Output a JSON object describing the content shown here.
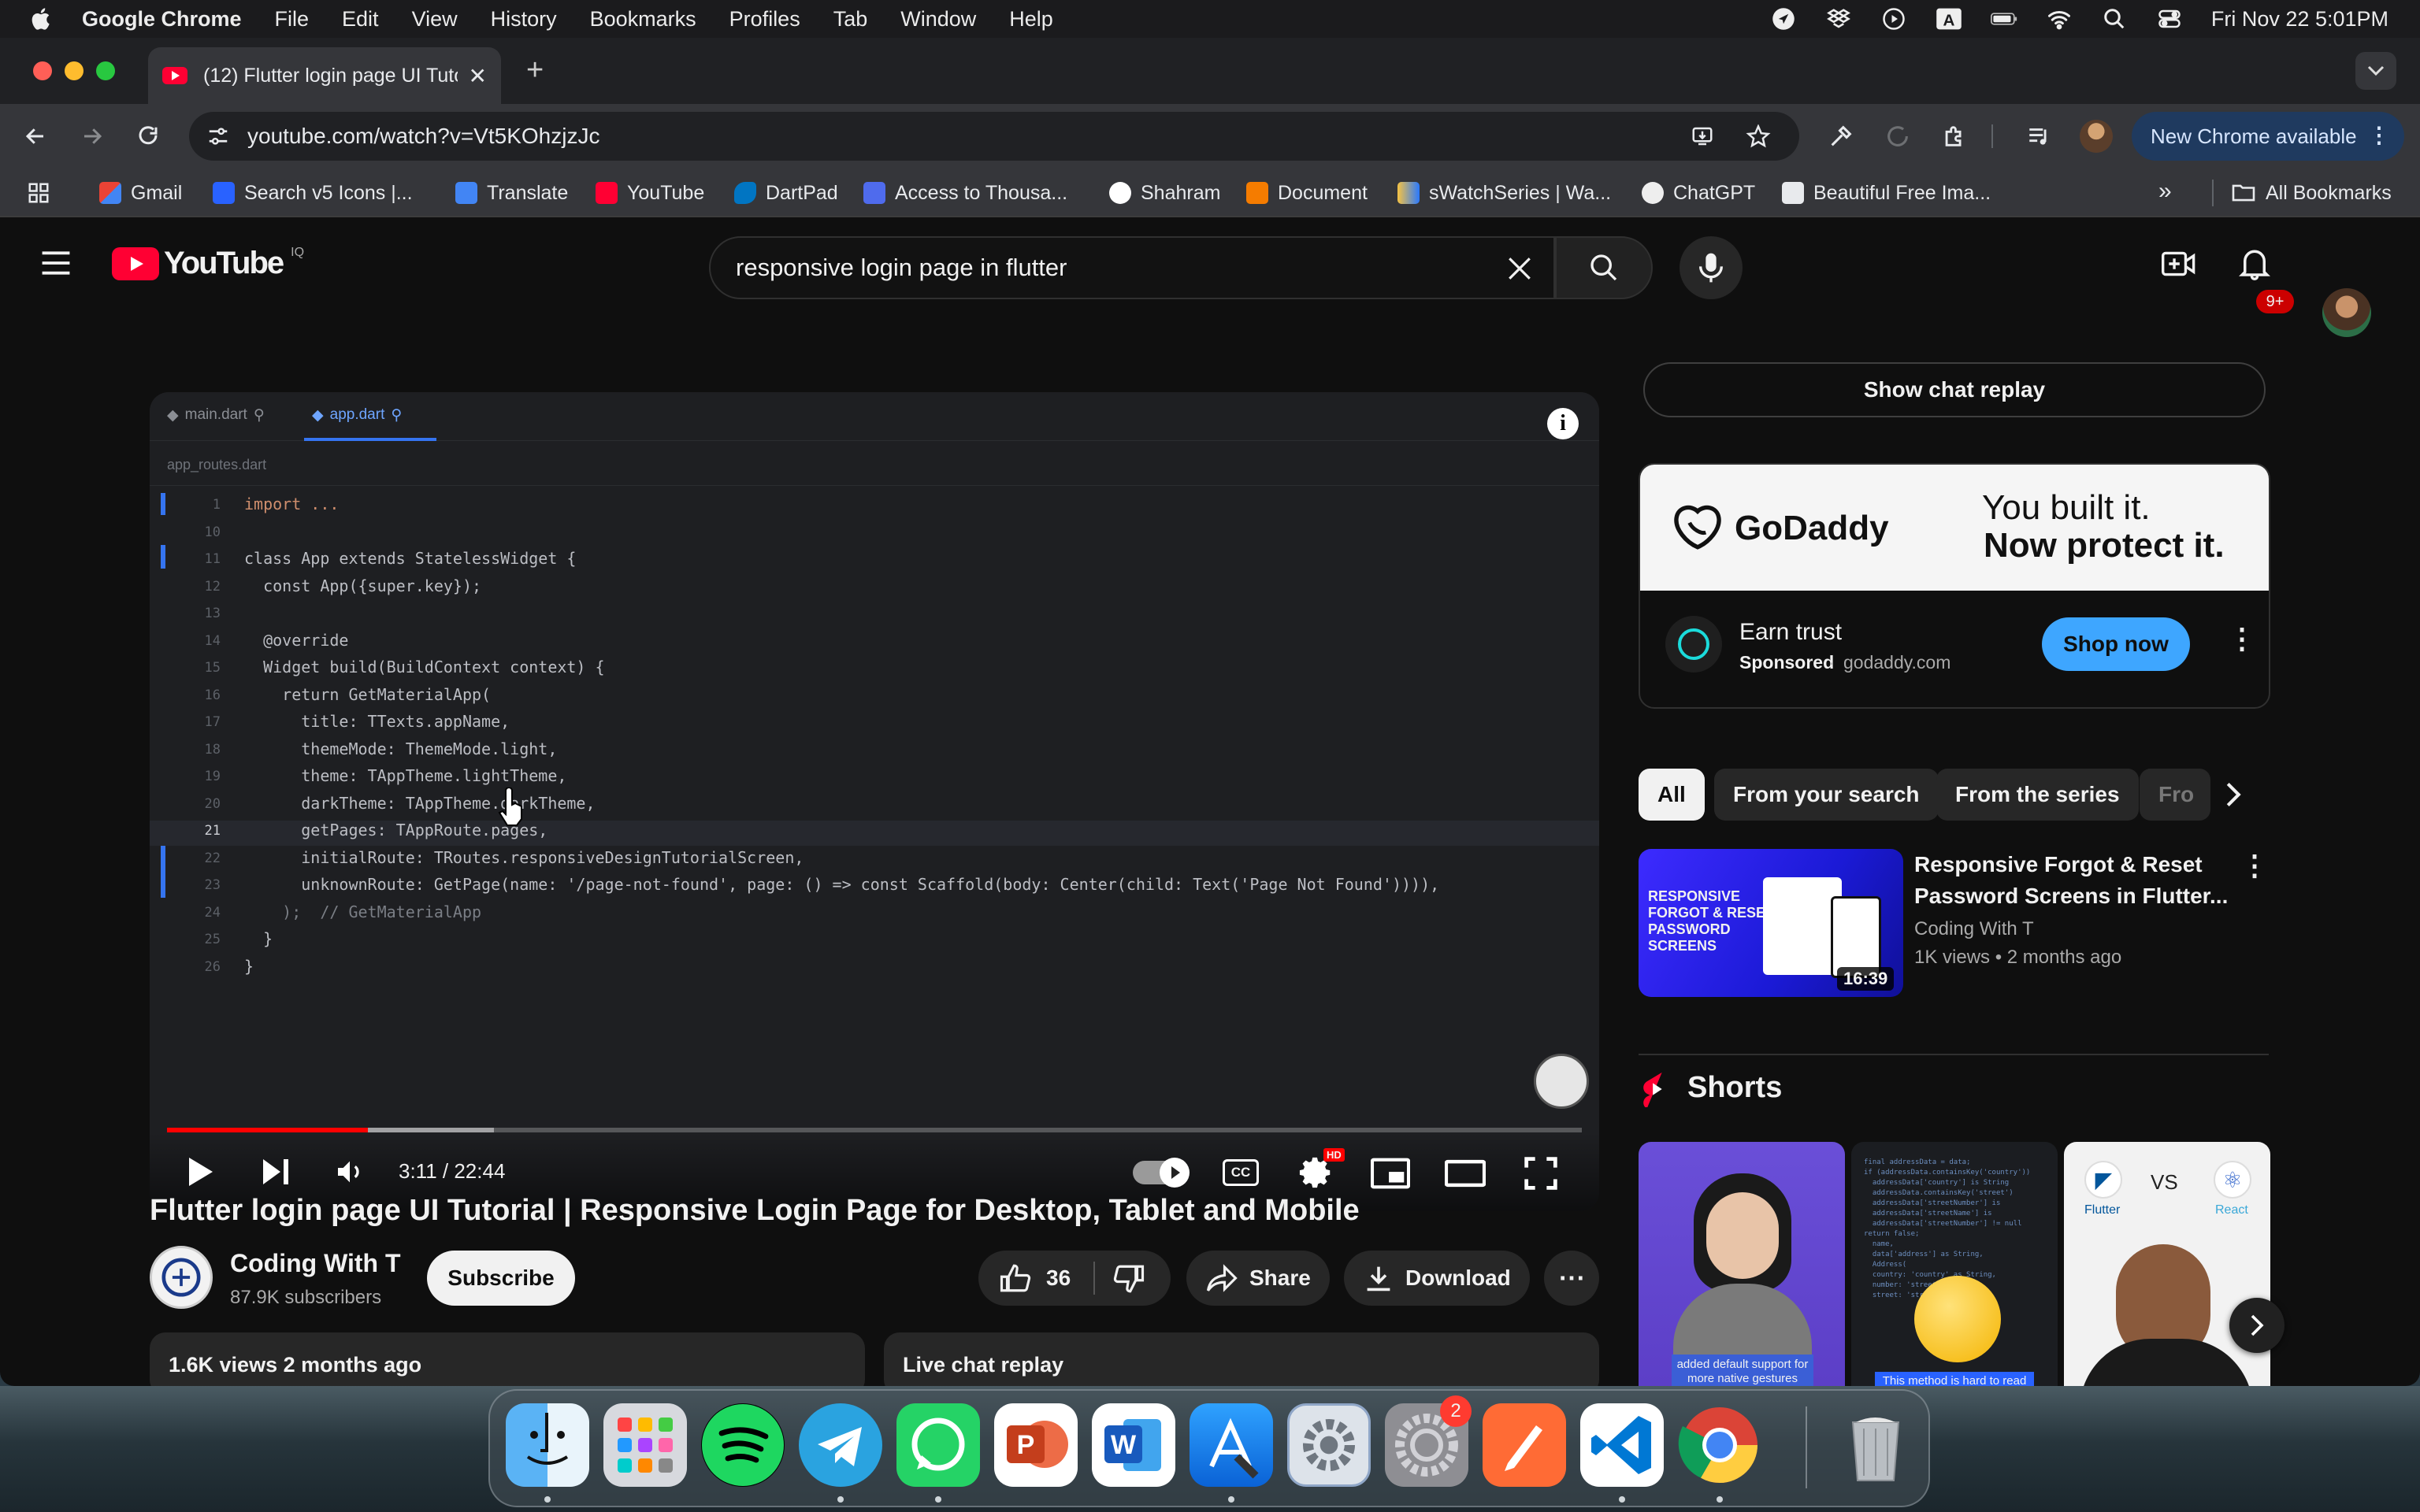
{
  "menubar": {
    "app": "Google Chrome",
    "items": [
      "File",
      "Edit",
      "View",
      "History",
      "Bookmarks",
      "Profiles",
      "Tab",
      "Window",
      "Help"
    ],
    "clock": "Fri Nov 22  5:01PM",
    "status_icons": [
      "location-icon",
      "dropbox-icon",
      "play-icon",
      "a-icon",
      "battery-icon",
      "wifi-icon",
      "search-icon",
      "control-center-icon"
    ]
  },
  "browser": {
    "tab_title": "(12) Flutter login page UI Tuto",
    "url": "youtube.com/watch?v=Vt5KOhzjzJc",
    "new_chrome": "New Chrome available",
    "bookmarks": [
      "Gmail",
      "Search v5 Icons |...",
      "Translate",
      "YouTube",
      "DartPad",
      "Access to Thousa...",
      "Shahram",
      "Document",
      "sWatchSeries | Wa...",
      "ChatGPT",
      "Beautiful Free Ima..."
    ],
    "all_bookmarks": "All Bookmarks",
    "more": "»"
  },
  "youtube": {
    "logo_text": "YouTube",
    "logo_sup": "IQ",
    "search_value": "responsive login page  in flutter",
    "notif_badge": "9+"
  },
  "player": {
    "tabs": [
      "main.dart",
      "app.dart"
    ],
    "breadcrumb": "app_routes.dart",
    "code_lines": [
      {
        "n": "1",
        "t": "import ..."
      },
      {
        "n": "10",
        "t": ""
      },
      {
        "n": "11",
        "t": "class App extends StatelessWidget {"
      },
      {
        "n": "12",
        "t": "  const App({super.key});"
      },
      {
        "n": "13",
        "t": ""
      },
      {
        "n": "14",
        "t": "  @override"
      },
      {
        "n": "15",
        "t": "  Widget build(BuildContext context) {"
      },
      {
        "n": "16",
        "t": "    return GetMaterialApp("
      },
      {
        "n": "17",
        "t": "      title: TTexts.appName,"
      },
      {
        "n": "18",
        "t": "      themeMode: ThemeMode.light,"
      },
      {
        "n": "19",
        "t": "      theme: TAppTheme.lightTheme,"
      },
      {
        "n": "20",
        "t": "      darkTheme: TAppTheme.darkTheme,"
      },
      {
        "n": "21",
        "t": "      getPages: TAppRoute.pages,"
      },
      {
        "n": "22",
        "t": "      initialRoute: TRoutes.responsiveDesignTutorialScreen,"
      },
      {
        "n": "23",
        "t": "      unknownRoute: GetPage(name: '/page-not-found', page: () => const Scaffold(body: Center(child: Text('Page Not Found')))),"
      },
      {
        "n": "24",
        "t": "    );  // GetMaterialApp"
      },
      {
        "n": "25",
        "t": "  }"
      },
      {
        "n": "26",
        "t": "}"
      }
    ],
    "time": "3:11 / 22:44",
    "progress": 0.142,
    "hd_badge": "HD",
    "cc_label": "CC"
  },
  "video": {
    "title": "Flutter login page UI Tutorial | Responsive Login Page for Desktop, Tablet and Mobile",
    "channel": "Coding With T",
    "subscribers": "87.9K subscribers",
    "subscribe": "Subscribe",
    "likes": "36",
    "share": "Share",
    "download": "Download",
    "views": "1.6K views  2 months ago",
    "live_chat": "Live chat replay"
  },
  "sidebar": {
    "show_chat": "Show chat replay",
    "ad": {
      "brand": "GoDaddy",
      "tagline1": "You built it.",
      "tagline2": "Now protect it.",
      "title": "Earn trust",
      "sponsored": "Sponsored",
      "domain": "godaddy.com",
      "cta": "Shop now"
    },
    "chips": [
      "All",
      "From your search",
      "From the series",
      "Fro"
    ],
    "rec": {
      "title1": "Responsive Forgot & Reset",
      "title2": "Password Screens in Flutter...",
      "channel": "Coding With T",
      "meta": "1K views  • 2 months ago",
      "duration": "16:39",
      "thumb_text": [
        "RESPONSIVE",
        "FORGOT & RESET",
        "PASSWORD",
        "SCREENS"
      ]
    },
    "shorts_title": "Shorts",
    "shorts": [
      {
        "caption": "added default support for more native gestures"
      },
      {
        "caption": "This method is hard to read"
      },
      {
        "left": "Flutter",
        "vs": "VS",
        "right": "React"
      }
    ]
  },
  "dock": {
    "apps": [
      "Finder",
      "Launchpad",
      "Spotify",
      "Telegram",
      "WhatsApp",
      "PowerPoint",
      "Word",
      "Xcode",
      "Settings Utility",
      "System Settings",
      "Paw",
      "VS Code",
      "Chrome",
      "Trash"
    ],
    "settings_badge": "2"
  }
}
